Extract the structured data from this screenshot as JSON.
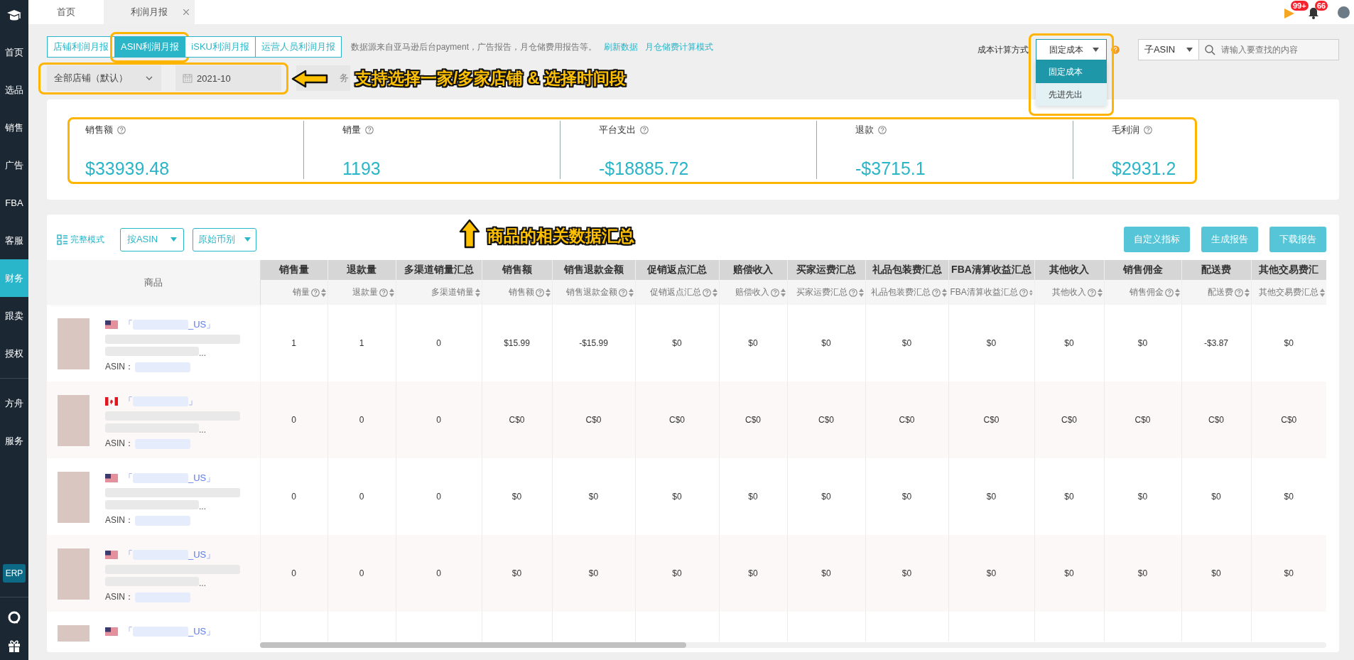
{
  "sidebar": {
    "items": [
      {
        "label": "首页",
        "selected": false
      },
      {
        "label": "选品",
        "selected": false
      },
      {
        "label": "销售",
        "selected": false
      },
      {
        "label": "广告",
        "selected": false
      },
      {
        "label": "FBA",
        "selected": false
      },
      {
        "label": "客服",
        "selected": false
      },
      {
        "label": "财务",
        "selected": true
      },
      {
        "label": "跟卖",
        "selected": false
      },
      {
        "label": "授权",
        "selected": false
      }
    ],
    "more_items": [
      {
        "label": "方舟",
        "selected": false
      },
      {
        "label": "服务",
        "selected": false
      }
    ],
    "erp": "ERP"
  },
  "top_tabs": [
    {
      "label": "首页",
      "selected": false,
      "closable": false
    },
    {
      "label": "利润月报",
      "selected": true,
      "closable": true
    }
  ],
  "notifications": [
    {
      "kind": "flag",
      "badge": "99+"
    },
    {
      "kind": "bell",
      "badge": "66"
    }
  ],
  "report_tabs": [
    {
      "label": "店铺利润月报",
      "selected": false,
      "highlighted": false
    },
    {
      "label": "ASIN利润月报",
      "selected": true,
      "highlighted": true
    },
    {
      "label": "iSKU利润月报",
      "selected": false,
      "highlighted": false
    },
    {
      "label": "运营人员利润月报",
      "selected": false,
      "highlighted": false
    }
  ],
  "info_text": "数据源来自亚马逊后台payment，广告报告，月仓储费用报告等。",
  "links": [
    "刷新数据",
    "月仓储费计算模式"
  ],
  "filters": {
    "store": "全部店铺（默认）",
    "date": "2021-10",
    "partial": "务",
    "highlighted": true
  },
  "cost_method": {
    "label": "成本计算方式",
    "value": "固定成本",
    "expanded": true,
    "highlighted": true,
    "options": [
      {
        "label": "固定成本",
        "selected": true
      },
      {
        "label": "先进先出",
        "selected": false
      }
    ]
  },
  "search": {
    "scope": "子ASIN",
    "placeholder": "请输入要查找的内容"
  },
  "summary": {
    "highlighted": true,
    "metrics": [
      {
        "label": "销售额",
        "value": "$33939.48"
      },
      {
        "label": "销量",
        "value": "1193"
      },
      {
        "label": "平台支出",
        "value": "-$18885.72"
      },
      {
        "label": "退款",
        "value": "-$3715.1"
      },
      {
        "label": "毛利润",
        "value": "$2931.2"
      }
    ]
  },
  "annotations": [
    {
      "kind": "left",
      "text": "支持选择一家/多家店铺 & 选择时间段"
    },
    {
      "kind": "up",
      "text": "商品的相关数据汇总"
    }
  ],
  "toolbar": {
    "mode": "完整模式",
    "dropdowns": [
      "按ASIN",
      "原始币别"
    ],
    "buttons": [
      "自定义指标",
      "生成报告",
      "下载报告"
    ]
  },
  "table": {
    "product_header": "商品",
    "columns": [
      {
        "title": "销售量",
        "sub": "销量",
        "help": true
      },
      {
        "title": "退款量",
        "sub": "退款量",
        "help": true
      },
      {
        "title": "多渠道销量汇总",
        "sub": "多渠道销量",
        "help": false
      },
      {
        "title": "销售额",
        "sub": "销售额",
        "help": true
      },
      {
        "title": "销售退款金额",
        "sub": "销售退款金额",
        "help": true
      },
      {
        "title": "促销返点汇总",
        "sub": "促销返点汇总",
        "help": true
      },
      {
        "title": "赔偿收入",
        "sub": "赔偿收入",
        "help": true
      },
      {
        "title": "买家运费汇总",
        "sub": "买家运费汇总",
        "help": true
      },
      {
        "title": "礼品包装费汇总",
        "sub": "礼品包装费汇总",
        "help": true
      },
      {
        "title": "FBA清算收益汇总",
        "sub": "FBA清算收益汇总",
        "help": true
      },
      {
        "title": "其他收入",
        "sub": "其他收入",
        "help": true
      },
      {
        "title": "销售佣金",
        "sub": "销售佣金",
        "help": true
      },
      {
        "title": "配送费",
        "sub": "配送费",
        "help": true
      },
      {
        "title": "其他交易费汇",
        "sub": "其他交易费汇总",
        "help": false
      }
    ],
    "rows": [
      {
        "flag": {
          "kind": "us"
        },
        "store_open": "「",
        "store_close": "_US」",
        "title_end": "...",
        "asin_label": "ASIN：",
        "cells": [
          "1",
          "1",
          "0",
          "$15.99",
          "-$15.99",
          "$0",
          "$0",
          "$0",
          "$0",
          "$0",
          "$0",
          "$0",
          "-$3.87",
          "$0"
        ]
      },
      {
        "flag": {
          "kind": "ca"
        },
        "store_open": "「",
        "store_close": "」",
        "title_end": "...",
        "asin_label": "ASIN：",
        "cells": [
          "0",
          "0",
          "0",
          "C$0",
          "C$0",
          "C$0",
          "C$0",
          "C$0",
          "C$0",
          "C$0",
          "C$0",
          "C$0",
          "C$0",
          "C$0"
        ]
      },
      {
        "flag": {
          "kind": "us"
        },
        "store_open": "「",
        "store_close": "_US」",
        "title_end": "...",
        "asin_label": "ASIN：",
        "cells": [
          "0",
          "0",
          "0",
          "$0",
          "$0",
          "$0",
          "$0",
          "$0",
          "$0",
          "$0",
          "$0",
          "$0",
          "$0",
          "$0"
        ]
      },
      {
        "flag": {
          "kind": "us"
        },
        "store_open": "「",
        "store_close": "_US」",
        "title_end": "...",
        "asin_label": "ASIN：",
        "cells": [
          "0",
          "0",
          "0",
          "$0",
          "$0",
          "$0",
          "$0",
          "$0",
          "$0",
          "$0",
          "$0",
          "$0",
          "$0",
          "$0"
        ]
      },
      {
        "flag": {
          "kind": "us"
        },
        "store_open": "「",
        "store_close": "_US」"
      }
    ]
  }
}
